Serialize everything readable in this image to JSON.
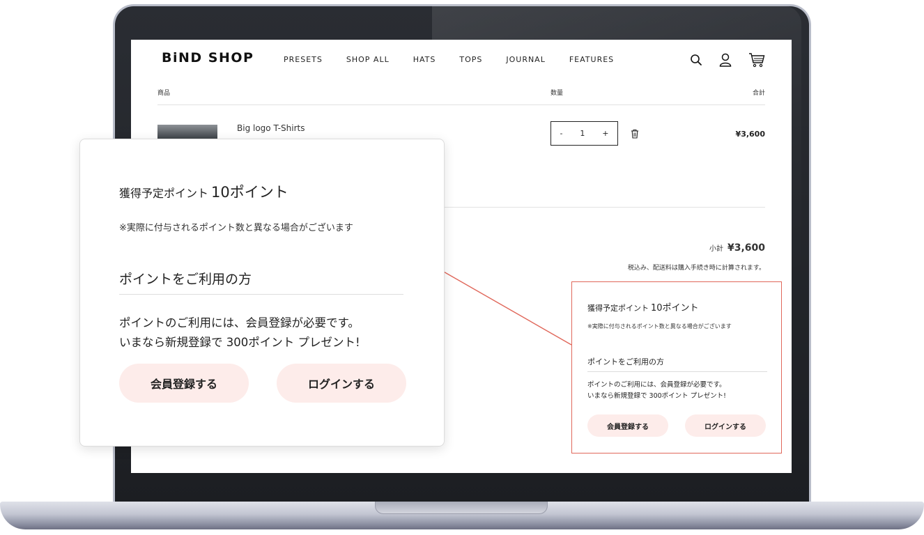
{
  "header": {
    "brand": "BiND SHOP",
    "nav": [
      "PRESETS",
      "SHOP ALL",
      "HATS",
      "TOPS",
      "JOURNAL",
      "FEATURES"
    ]
  },
  "cart": {
    "col_item": "商品",
    "col_qty": "数量",
    "col_total": "合計",
    "item": {
      "name": "Big logo T-Shirts",
      "qty_minus": "-",
      "qty": "1",
      "qty_plus": "+",
      "price": "¥3,600"
    },
    "subtotal_label": "小計",
    "subtotal_value": "¥3,600",
    "tax_note": "税込み、配送料は購入手続き時に計算されます。"
  },
  "points": {
    "title_prefix": "獲得予定ポイント",
    "title_value": "10ポイント",
    "note": "※実際に付与されるポイント数と異なる場合がございます",
    "section_heading": "ポイントをご利用の方",
    "body_line1": "ポイントのご利用には、会員登録が必要です。",
    "body_line2": "いまなら新規登録で 300ポイント プレゼント!",
    "register_button": "会員登録する",
    "login_button": "ログインする"
  },
  "colors": {
    "accent": "#e0675a",
    "button_bg": "#fdecea"
  }
}
